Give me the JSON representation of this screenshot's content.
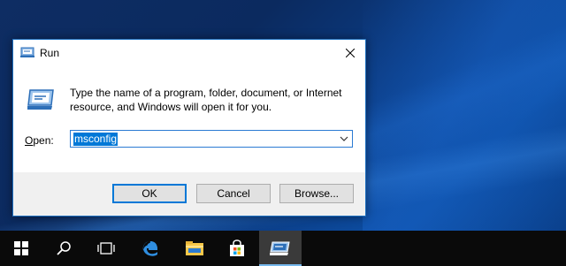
{
  "dialog": {
    "title": "Run",
    "description": "Type the name of a program, folder, document, or Internet resource, and Windows will open it for you.",
    "open_label": "pen:",
    "open_label_accel": "O",
    "input_value": "msconfig",
    "buttons": {
      "ok": "OK",
      "cancel": "Cancel",
      "browse": "Browse..."
    }
  },
  "taskbar": {
    "items": [
      "start-icon",
      "search-icon",
      "task-view-icon",
      "edge-icon",
      "file-explorer-icon",
      "store-icon",
      "run-icon"
    ],
    "active": "run-icon"
  },
  "colors": {
    "accent": "#0078d7",
    "taskbar": "#0a0a0a",
    "dialog_bg": "#f0f0f0"
  }
}
